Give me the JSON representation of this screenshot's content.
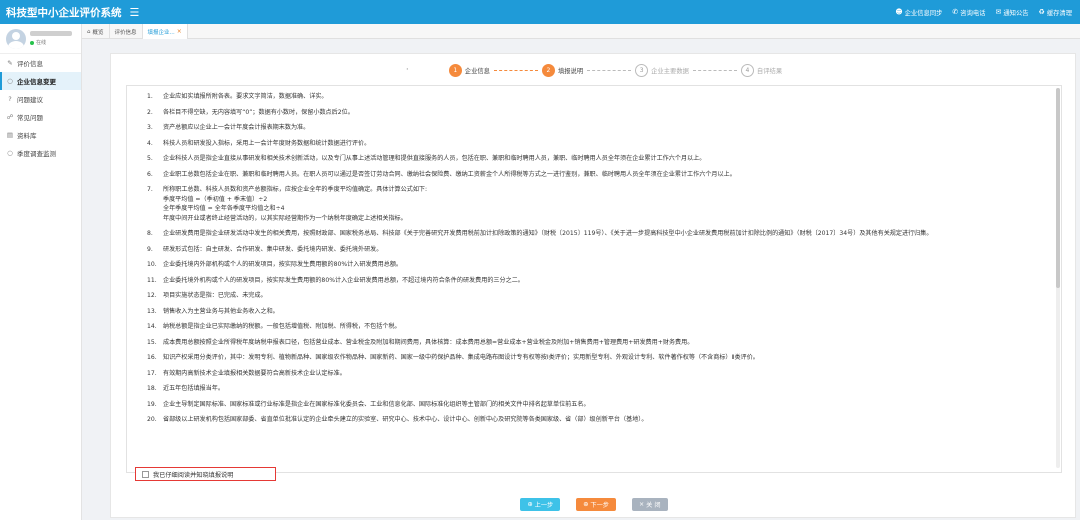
{
  "app": {
    "title": "科技型中小企业评价系统",
    "menu_icon": "hamburger-icon",
    "actions": [
      {
        "icon": "user-icon",
        "label": "企业信息同步"
      },
      {
        "icon": "phone-icon",
        "label": "咨询电话"
      },
      {
        "icon": "bell-icon",
        "label": "通知公告"
      },
      {
        "icon": "trash-icon",
        "label": "缓存清理"
      }
    ]
  },
  "user": {
    "status": "在线"
  },
  "sidebar": {
    "items": [
      {
        "icon": "edit-icon",
        "label": "评价信息"
      },
      {
        "icon": "circle-icon",
        "label": "企业信息变更"
      },
      {
        "icon": "question-icon",
        "label": "问题建议"
      },
      {
        "icon": "comment-icon",
        "label": "常见问题"
      },
      {
        "icon": "folder-icon",
        "label": "资料库"
      },
      {
        "icon": "circle-icon",
        "label": "季度调查监测"
      }
    ]
  },
  "tabs": [
    {
      "icon": "home-icon",
      "label": "概览"
    },
    {
      "label": "评价信息"
    },
    {
      "label": "填报企业..."
    }
  ],
  "stepper": {
    "lead": "·",
    "steps": [
      {
        "n": "1",
        "label": "企业信息",
        "done": true
      },
      {
        "n": "2",
        "label": "填报说明",
        "done": true
      },
      {
        "n": "3",
        "label": "企业主要数据",
        "done": false
      },
      {
        "n": "4",
        "label": "自评结果",
        "done": false
      }
    ]
  },
  "notes": [
    {
      "n": "1.",
      "text": "企业应如实填报所附各表。要求文字简洁，数据准确、详实。"
    },
    {
      "n": "2.",
      "text": "各栏目不得空缺，无内容填写“0”；数据有小数时，保留小数点后2位。"
    },
    {
      "n": "3.",
      "text": "资产总额应以企业上一会计年度会计报表期末数为准。"
    },
    {
      "n": "4.",
      "text": "科技人员和研发投入指标，采用上一会计年度财务数据和统计数据进行评价。"
    },
    {
      "n": "5.",
      "text": "企业科技人员是指企业直接从事研发和相关技术创新活动，以及专门从事上述活动管理和提供直接服务的人员，包括在职、兼职和临时聘用人员，兼职、临时聘用人员全年须在企业累计工作六个月以上。"
    },
    {
      "n": "6.",
      "text": "企业职工总数包括企业在职、兼职和临时聘用人员。在职人员可以通过是否签订劳动合同、缴纳社会保险费、缴纳工资薪金个人所得税等方式之一进行鉴别，兼职、临时聘用人员全年须在企业累计工作六个月以上。"
    },
    {
      "n": "7.",
      "text": "所称职工总数、科技人员数和资产总额指标，应按企业全年的季度平均值确定。具体计算公式如下:\n季度平均值 =（季初值 + 季末值）÷2\n全年季度平均值 = 全年各季度平均值之和÷4\n年度中间开业或者终止经营活动的，以其实际经营期作为一个纳税年度确定上述相关指标。"
    },
    {
      "n": "8.",
      "text": "企业研发费用是指企业研发活动中发生的相关费用，按照财政部、国家税务总局、科技部《关于完善研究开发费用税前加计扣除政策的通知》（财税〔2015〕119号）、《关于进一步提高科技型中小企业研发费用税前加计扣除比例的通知》（财税〔2017〕34号）及其他有关规定进行归集。"
    },
    {
      "n": "9.",
      "text": "研发形式包括：自主研发、合作研发、集中研发、委托境内研发、委托境外研发。"
    },
    {
      "n": "10.",
      "text": "企业委托境内外部机构或个人的研发项目，按实际发生费用额的80%计入研发费用总额。"
    },
    {
      "n": "11.",
      "text": "企业委托境外机构或个人的研发项目，按实际发生费用额的80%计入企业研发费用总额，不超过境内符合条件的研发费用的三分之二。"
    },
    {
      "n": "12.",
      "text": "项目实施状态是指：已完成、未完成。"
    },
    {
      "n": "13.",
      "text": "销售收入为主营业务与其他业务收入之和。"
    },
    {
      "n": "14.",
      "text": "纳税总额是指企业已实际缴纳的税额。一般包括增值税、附加税、所得税，不包括个税。"
    },
    {
      "n": "15.",
      "text": "成本费用总额按照企业所得税年度纳税申报表口径，包括营业成本、营业税金及附加和期间费用，具体核算：成本费用总额=营业成本+营业税金及附加+销售费用+管理费用+研发费用+财务费用。"
    },
    {
      "n": "16.",
      "text": "知识产权采用分类评价，其中：发明专利、植物新品种、国家级农作物品种、国家新药、国家一级中药保护品种、集成电路布图设计专有权等按Ⅰ类评价；实用新型专利、外观设计专利、软件著作权等（不含商标）Ⅱ类评价。"
    },
    {
      "n": "17.",
      "text": "有效期内高新技术企业填报相关数据要符合高新技术企业认定标准。"
    },
    {
      "n": "18.",
      "text": "近五年包括填报当年。"
    },
    {
      "n": "19.",
      "text": "企业主导制定国际标准、国家标准或行业标准是指企业在国家标准化委员会、工业和信息化部、国际标准化组织等主管部门的相关文件中排名起草单位前五名。"
    },
    {
      "n": "20.",
      "text": "省部级以上研发机构包括国家部委、省直单位批准认定的企业牵头建立的实验室、研究中心、技术中心、设计中心、创新中心及研究院等各类国家级、省（部）级创新平台（基地）。"
    }
  ],
  "ack": {
    "label": "我已仔细阅读并知晓填报说明"
  },
  "buttons": {
    "prev": {
      "icon": "arrow-left-icon",
      "label": "上一步"
    },
    "next": {
      "icon": "arrow-right-icon",
      "label": "下一步"
    },
    "close": {
      "icon": "close-icon",
      "label": "关 闭"
    }
  }
}
